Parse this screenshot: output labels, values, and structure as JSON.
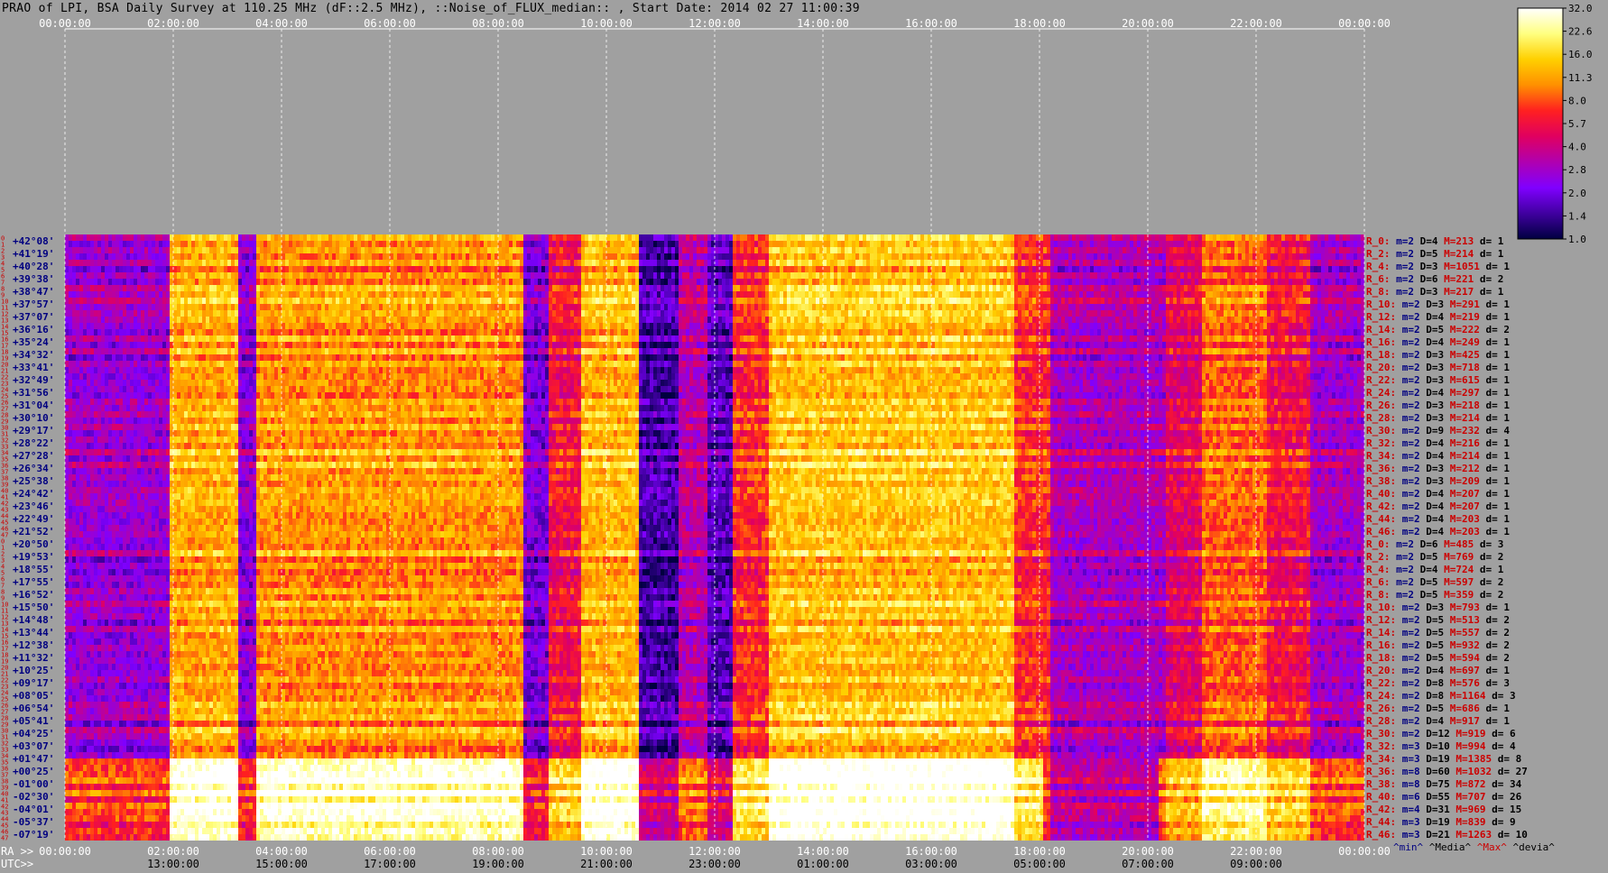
{
  "title": "PRAO of LPI, BSA Daily Survey at 110.25 MHz (dF::2.5 MHz), ::Noise_of_FLUX_median:: , Start Date: 2014 02 27 11:00:39",
  "colors": {
    "background": "#a0a0a0",
    "axis_text": "#ffffff",
    "dec_text": "#000080",
    "row_text": "#cc0000",
    "grid": "#ffffff"
  },
  "chart_data": {
    "type": "heatmap",
    "ra_axis_label": "RA >>",
    "utc_axis_label": "UTC>>",
    "ra_ticks_top": [
      "00:00:00",
      "02:00:00",
      "04:00:00",
      "06:00:00",
      "08:00:00",
      "10:00:00",
      "12:00:00",
      "14:00:00",
      "16:00:00",
      "18:00:00",
      "20:00:00",
      "22:00:00",
      "00:00:00"
    ],
    "ra_ticks_bottom": [
      "00:00:00",
      "02:00:00",
      "04:00:00",
      "06:00:00",
      "08:00:00",
      "10:00:00",
      "12:00:00",
      "14:00:00",
      "16:00:00",
      "18:00:00",
      "20:00:00",
      "22:00:00",
      "00:00:00"
    ],
    "utc_ticks": [
      "13:00:00",
      "15:00:00",
      "17:00:00",
      "19:00:00",
      "21:00:00",
      "23:00:00",
      "01:00:00",
      "03:00:00",
      "05:00:00",
      "07:00:00",
      "09:00:00"
    ],
    "declinations": [
      "+42°08'",
      "+41°19'",
      "+40°28'",
      "+39°38'",
      "+38°47'",
      "+37°57'",
      "+37°07'",
      "+36°16'",
      "+35°24'",
      "+34°32'",
      "+33°41'",
      "+32°49'",
      "+31°56'",
      "+31°04'",
      "+30°10'",
      "+29°17'",
      "+28°22'",
      "+27°28'",
      "+26°34'",
      "+25°38'",
      "+24°42'",
      "+23°46'",
      "+22°49'",
      "+21°52'",
      "+20°50'",
      "+19°53'",
      "+18°55'",
      "+17°55'",
      "+16°52'",
      "+15°50'",
      "+14°48'",
      "+13°44'",
      "+12°38'",
      "+11°32'",
      "+10°25'",
      "+09°17'",
      "+08°05'",
      "+06°54'",
      "+05°41'",
      "+04°25'",
      "+03°07'",
      "+01°47'",
      "+00°25'",
      "-01°00'",
      "-02°30'",
      "-04°01'",
      "-05°37'",
      "-07°19'"
    ],
    "row_numbers": [
      "0",
      "1",
      "2",
      "3",
      "4",
      "5",
      "6",
      "7",
      "8",
      "9",
      "10",
      "11",
      "12",
      "13",
      "14",
      "15",
      "16",
      "17",
      "18",
      "19",
      "20",
      "21",
      "22",
      "23",
      "24",
      "25",
      "26",
      "27",
      "28",
      "29",
      "30",
      "31",
      "32",
      "33",
      "34",
      "35",
      "36",
      "37",
      "38",
      "39",
      "40",
      "41",
      "42",
      "43",
      "44",
      "45",
      "46",
      "47",
      "0",
      "1",
      "2",
      "3",
      "4",
      "5",
      "6",
      "7",
      "8",
      "9",
      "10",
      "11",
      "12",
      "13",
      "14",
      "15",
      "16",
      "17",
      "18",
      "19",
      "20",
      "21",
      "22",
      "23",
      "24",
      "25",
      "26",
      "27",
      "28",
      "29",
      "30",
      "31",
      "32",
      "33",
      "34",
      "35",
      "36",
      "37",
      "38",
      "39",
      "40",
      "41",
      "42",
      "43",
      "44",
      "45",
      "46",
      "47"
    ],
    "stats": [
      {
        "row": "R_0:",
        "m": "m=2",
        "D": "D=4",
        "M": "M=213",
        "d": "d= 1"
      },
      {
        "row": "R_2:",
        "m": "m=2",
        "D": "D=5",
        "M": "M=214",
        "d": "d= 1"
      },
      {
        "row": "R_4:",
        "m": "m=2",
        "D": "D=3",
        "M": "M=1051",
        "d": "d= 1"
      },
      {
        "row": "R_6:",
        "m": "m=2",
        "D": "D=6",
        "M": "M=221",
        "d": "d= 2"
      },
      {
        "row": "R_8:",
        "m": "m=2",
        "D": "D=3",
        "M": "M=217",
        "d": "d= 1"
      },
      {
        "row": "R_10:",
        "m": "m=2",
        "D": "D=3",
        "M": "M=291",
        "d": "d= 1"
      },
      {
        "row": "R_12:",
        "m": "m=2",
        "D": "D=4",
        "M": "M=219",
        "d": "d= 1"
      },
      {
        "row": "R_14:",
        "m": "m=2",
        "D": "D=5",
        "M": "M=222",
        "d": "d= 2"
      },
      {
        "row": "R_16:",
        "m": "m=2",
        "D": "D=4",
        "M": "M=249",
        "d": "d= 1"
      },
      {
        "row": "R_18:",
        "m": "m=2",
        "D": "D=3",
        "M": "M=425",
        "d": "d= 1"
      },
      {
        "row": "R_20:",
        "m": "m=2",
        "D": "D=3",
        "M": "M=718",
        "d": "d= 1"
      },
      {
        "row": "R_22:",
        "m": "m=2",
        "D": "D=3",
        "M": "M=615",
        "d": "d= 1"
      },
      {
        "row": "R_24:",
        "m": "m=2",
        "D": "D=4",
        "M": "M=297",
        "d": "d= 1"
      },
      {
        "row": "R_26:",
        "m": "m=2",
        "D": "D=3",
        "M": "M=218",
        "d": "d= 1"
      },
      {
        "row": "R_28:",
        "m": "m=2",
        "D": "D=3",
        "M": "M=214",
        "d": "d= 1"
      },
      {
        "row": "R_30:",
        "m": "m=2",
        "D": "D=9",
        "M": "M=232",
        "d": "d= 4"
      },
      {
        "row": "R_32:",
        "m": "m=2",
        "D": "D=4",
        "M": "M=216",
        "d": "d= 1"
      },
      {
        "row": "R_34:",
        "m": "m=2",
        "D": "D=4",
        "M": "M=214",
        "d": "d= 1"
      },
      {
        "row": "R_36:",
        "m": "m=2",
        "D": "D=3",
        "M": "M=212",
        "d": "d= 1"
      },
      {
        "row": "R_38:",
        "m": "m=2",
        "D": "D=3",
        "M": "M=209",
        "d": "d= 1"
      },
      {
        "row": "R_40:",
        "m": "m=2",
        "D": "D=4",
        "M": "M=207",
        "d": "d= 1"
      },
      {
        "row": "R_42:",
        "m": "m=2",
        "D": "D=4",
        "M": "M=207",
        "d": "d= 1"
      },
      {
        "row": "R_44:",
        "m": "m=2",
        "D": "D=4",
        "M": "M=203",
        "d": "d= 1"
      },
      {
        "row": "R_46:",
        "m": "m=2",
        "D": "D=4",
        "M": "M=203",
        "d": "d= 1"
      },
      {
        "row": "R_0:",
        "m": "m=2",
        "D": "D=6",
        "M": "M=485",
        "d": "d= 3"
      },
      {
        "row": "R_2:",
        "m": "m=2",
        "D": "D=5",
        "M": "M=769",
        "d": "d= 2"
      },
      {
        "row": "R_4:",
        "m": "m=2",
        "D": "D=4",
        "M": "M=724",
        "d": "d= 1"
      },
      {
        "row": "R_6:",
        "m": "m=2",
        "D": "D=5",
        "M": "M=597",
        "d": "d= 2"
      },
      {
        "row": "R_8:",
        "m": "m=2",
        "D": "D=5",
        "M": "M=359",
        "d": "d= 2"
      },
      {
        "row": "R_10:",
        "m": "m=2",
        "D": "D=3",
        "M": "M=793",
        "d": "d= 1"
      },
      {
        "row": "R_12:",
        "m": "m=2",
        "D": "D=5",
        "M": "M=513",
        "d": "d= 2"
      },
      {
        "row": "R_14:",
        "m": "m=2",
        "D": "D=5",
        "M": "M=557",
        "d": "d= 2"
      },
      {
        "row": "R_16:",
        "m": "m=2",
        "D": "D=5",
        "M": "M=932",
        "d": "d= 2"
      },
      {
        "row": "R_18:",
        "m": "m=2",
        "D": "D=5",
        "M": "M=594",
        "d": "d= 2"
      },
      {
        "row": "R_20:",
        "m": "m=2",
        "D": "D=4",
        "M": "M=697",
        "d": "d= 1"
      },
      {
        "row": "R_22:",
        "m": "m=2",
        "D": "D=8",
        "M": "M=576",
        "d": "d= 3"
      },
      {
        "row": "R_24:",
        "m": "m=2",
        "D": "D=8",
        "M": "M=1164",
        "d": "d= 3"
      },
      {
        "row": "R_26:",
        "m": "m=2",
        "D": "D=5",
        "M": "M=686",
        "d": "d= 1"
      },
      {
        "row": "R_28:",
        "m": "m=2",
        "D": "D=4",
        "M": "M=917",
        "d": "d= 1"
      },
      {
        "row": "R_30:",
        "m": "m=2",
        "D": "D=12",
        "M": "M=919",
        "d": "d= 6"
      },
      {
        "row": "R_32:",
        "m": "m=3",
        "D": "D=10",
        "M": "M=994",
        "d": "d= 4"
      },
      {
        "row": "R_34:",
        "m": "m=3",
        "D": "D=19",
        "M": "M=1385",
        "d": "d= 8"
      },
      {
        "row": "R_36:",
        "m": "m=8",
        "D": "D=60",
        "M": "M=1032",
        "d": "d= 27"
      },
      {
        "row": "R_38:",
        "m": "m=8",
        "D": "D=75",
        "M": "M=872",
        "d": "d= 34"
      },
      {
        "row": "R_40:",
        "m": "m=6",
        "D": "D=55",
        "M": "M=707",
        "d": "d= 26"
      },
      {
        "row": "R_42:",
        "m": "m=4",
        "D": "D=31",
        "M": "M=969",
        "d": "d= 15"
      },
      {
        "row": "R_44:",
        "m": "m=3",
        "D": "D=19",
        "M": "M=839",
        "d": "d= 9"
      },
      {
        "row": "R_46:",
        "m": "m=3",
        "D": "D=21",
        "M": "M=1263",
        "d": "d= 10"
      }
    ],
    "stats_footer": {
      "min": "^min^",
      "media": "^Media^",
      "max": "^Max^",
      "devia": "^devia^"
    },
    "colorbar": {
      "ticks": [
        "32.0",
        "22.6",
        "16.0",
        "11.3",
        "8.0",
        "5.7",
        "4.0",
        "2.8",
        "2.0",
        "1.4",
        "1.0"
      ],
      "scale": "log",
      "range": [
        1.0,
        32.0
      ],
      "colormap": [
        "#ffffff",
        "#ffff80",
        "#ffd000",
        "#ff9000",
        "#ff2020",
        "#e00060",
        "#b000b0",
        "#8000ff",
        "#4000a0",
        "#000040"
      ]
    },
    "ra_range_hours": [
      0,
      24
    ],
    "row_count": 48
  }
}
